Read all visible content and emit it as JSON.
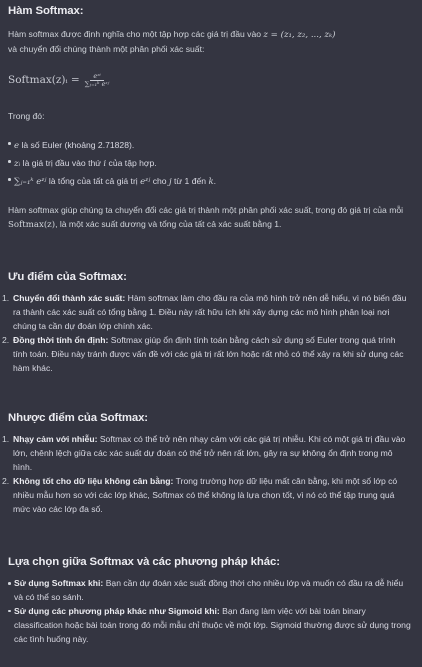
{
  "sections": {
    "intro": {
      "title": "Hàm Softmax:",
      "para1_a": "Hàm softmax được định nghĩa cho một tập hợp các giá trị đầu vào ",
      "para1_math": "z = (z₁, z₂, ..., zₖ)",
      "para1_b": "và chuyển đổi chúng thành một phân phối xác suất:",
      "formula_lhs": "Softmax(z)ᵢ =",
      "formula_num": "eᶻⁱ",
      "formula_den": "∑ⱼ₌₁ᵏ eᶻʲ",
      "where": "Trong đó:",
      "bullets": [
        {
          "math": "e",
          "text": " là số Euler (khoảng 2.71828)."
        },
        {
          "math": "zᵢ",
          "text": " là giá trị đầu vào thứ ",
          "math2": "i",
          "text2": " của tập hợp."
        },
        {
          "math": "∑ⱼ₌₁ᵏ eᶻʲ",
          "text": " là tổng của tất cả giá trị ",
          "math2": "eᶻʲ",
          "text2": " cho ",
          "math3": "j",
          "text3": " từ 1 đến ",
          "math4": "k",
          "text4": "."
        }
      ],
      "para2_a": "Hàm softmax giúp chúng ta chuyển đổi các giá trị thành một phân phối xác suất, trong đó giá trị của mỗi ",
      "para2_math": "Softmax(z)",
      "para2_b": ", là một xác suất dương và tổng của tất cả xác suất bằng 1."
    },
    "advantages": {
      "title": "Ưu điểm của Softmax:",
      "items": [
        {
          "marker": "1.",
          "bold": "Chuyển đổi thành xác suất:",
          "text": " Hàm softmax làm cho đầu ra của mô hình trở nên dễ hiểu, vì nó biến đầu ra thành các xác suất có tổng bằng 1. Điều này rất hữu ích khi xây dựng các mô hình phân loại nơi chúng ta cần dự đoán lớp chính xác."
        },
        {
          "marker": "2.",
          "bold": "Đồng thời tính ổn định:",
          "text": " Softmax giúp ổn định tính toán bằng cách sử dụng số Euler trong quá trình tính toán. Điều này tránh được vấn đề với các giá trị rất lớn hoặc rất nhỏ có thể xảy ra khi sử dụng các hàm khác."
        }
      ]
    },
    "disadvantages": {
      "title": "Nhược điểm của Softmax:",
      "items": [
        {
          "marker": "1.",
          "bold": "Nhạy cảm với nhiễu:",
          "text": " Softmax có thể trở nên nhạy cảm với các giá trị nhiễu. Khi có một giá trị đầu vào lớn, chênh lệch giữa các xác suất dự đoán có thể trở nên rất lớn, gây ra sự không ổn định trong mô hình."
        },
        {
          "marker": "2.",
          "bold": "Không tốt cho dữ liệu không cân bằng:",
          "text": " Trong trường hợp dữ liệu mất cân bằng, khi một số lớp có nhiều mẫu hơn so với các lớp khác, Softmax có thể không là lựa chọn tốt, vì nó có thể tập trung quá mức vào các lớp đa số."
        }
      ]
    },
    "choice": {
      "title": "Lựa chọn giữa Softmax và các phương pháp khác:",
      "items": [
        {
          "bold": "Sử dụng Softmax khi:",
          "text": " Bạn cần dự đoán xác suất đồng thời cho nhiều lớp và muốn có đầu ra dễ hiểu và có thể so sánh."
        },
        {
          "bold": "Sử dụng các phương pháp khác như Sigmoid khi:",
          "text": " Bạn đang làm việc với bài toán binary classification hoặc bài toán trong đó mỗi mẫu chỉ thuộc về một lớp. Sigmoid thường được sử dụng trong các tình huống này."
        }
      ]
    }
  }
}
